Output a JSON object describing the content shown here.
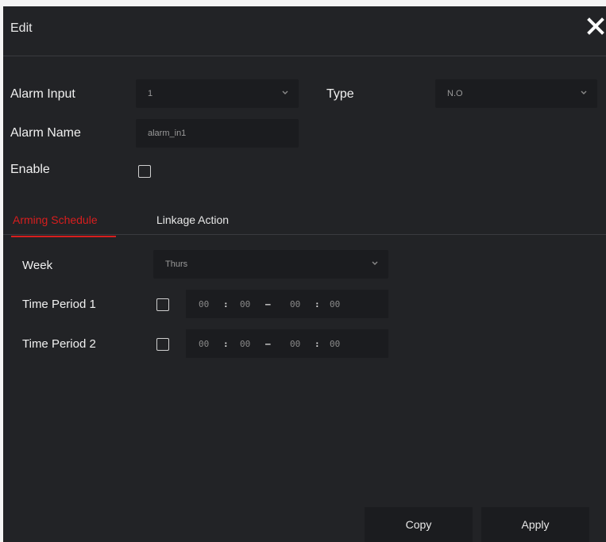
{
  "dialog": {
    "title": "Edit",
    "close_icon": "close-icon"
  },
  "form": {
    "alarm_input_label": "Alarm Input",
    "alarm_input_value": "1",
    "type_label": "Type",
    "type_value": "N.O",
    "alarm_name_label": "Alarm Name",
    "alarm_name_value": "alarm_in1",
    "enable_label": "Enable",
    "enable_checked": false
  },
  "tabs": [
    {
      "label": "Arming Schedule",
      "active": true
    },
    {
      "label": "Linkage Action",
      "active": false
    }
  ],
  "schedule": {
    "week_label": "Week",
    "week_value": "Thurs",
    "periods": [
      {
        "label": "Time Period 1",
        "checked": false,
        "start_h": "00",
        "start_m": "00",
        "end_h": "00",
        "end_m": "00"
      },
      {
        "label": "Time Period 2",
        "checked": false,
        "start_h": "00",
        "start_m": "00",
        "end_h": "00",
        "end_m": "00"
      }
    ],
    "colon": ":",
    "dash": "–"
  },
  "buttons": {
    "copy": "Copy",
    "apply": "Apply"
  },
  "colors": {
    "background": "#222326",
    "field": "#1b1c1f",
    "accent": "#d81e1e"
  }
}
